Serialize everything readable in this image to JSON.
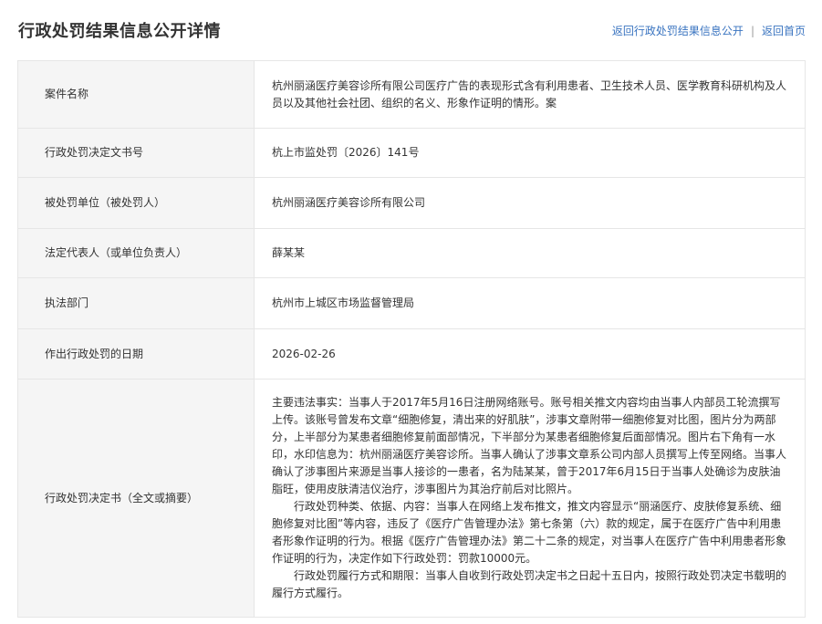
{
  "header": {
    "title": "行政处罚结果信息公开详情",
    "back_to_list": "返回行政处罚结果信息公开",
    "separator": "|",
    "back_home": "返回首页"
  },
  "rows": {
    "case_name": {
      "label": "案件名称",
      "value": "杭州丽涵医疗美容诊所有限公司医疗广告的表现形式含有利用患者、卫生技术人员、医学教育科研机构及人员以及其他社会社团、组织的名义、形象作证明的情形。案"
    },
    "decision_no": {
      "label": "行政处罚决定文书号",
      "value": "杭上市监处罚〔2026〕141号"
    },
    "party": {
      "label": "被处罚单位（被处罚人）",
      "value": "杭州丽涵医疗美容诊所有限公司"
    },
    "legal_rep": {
      "label": "法定代表人（或单位负责人）",
      "value": "薛某某"
    },
    "department": {
      "label": "执法部门",
      "value": "杭州市上城区市场监督管理局"
    },
    "decision_date": {
      "label": "作出行政处罚的日期",
      "value": "2026-02-26"
    },
    "decision_text": {
      "label": "行政处罚决定书（全文或摘要）",
      "paragraphs": [
        "主要违法事实：当事人于2017年5月16日注册网络账号。账号相关推文内容均由当事人内部员工轮流撰写上传。该账号曾发布文章“细胞修复，清出来的好肌肤”，涉事文章附带一细胞修复对比图，图片分为两部分，上半部分为某患者细胞修复前面部情况，下半部分为某患者细胞修复后面部情况。图片右下角有一水印，水印信息为：杭州丽涵医疗美容诊所。当事人确认了涉事文章系公司内部人员撰写上传至网络。当事人确认了涉事图片来源是当事人接诊的一患者，名为陆某某，曾于2017年6月15日于当事人处确诊为皮肤油脂旺，使用皮肤清洁仪治疗，涉事图片为其治疗前后对比照片。",
        "行政处罚种类、依据、内容：当事人在网络上发布推文，推文内容显示“丽涵医疗、皮肤修复系统、细胞修复对比图”等内容，违反了《医疗广告管理办法》第七条第（六）款的规定，属于在医疗广告中利用患者形象作证明的行为。根据《医疗广告管理办法》第二十二条的规定，对当事人在医疗广告中利用患者形象作证明的行为，决定作如下行政处罚：罚款10000元。",
        "行政处罚履行方式和期限：当事人自收到行政处罚决定书之日起十五日内，按照行政处罚决定书载明的履行方式履行。"
      ]
    }
  }
}
